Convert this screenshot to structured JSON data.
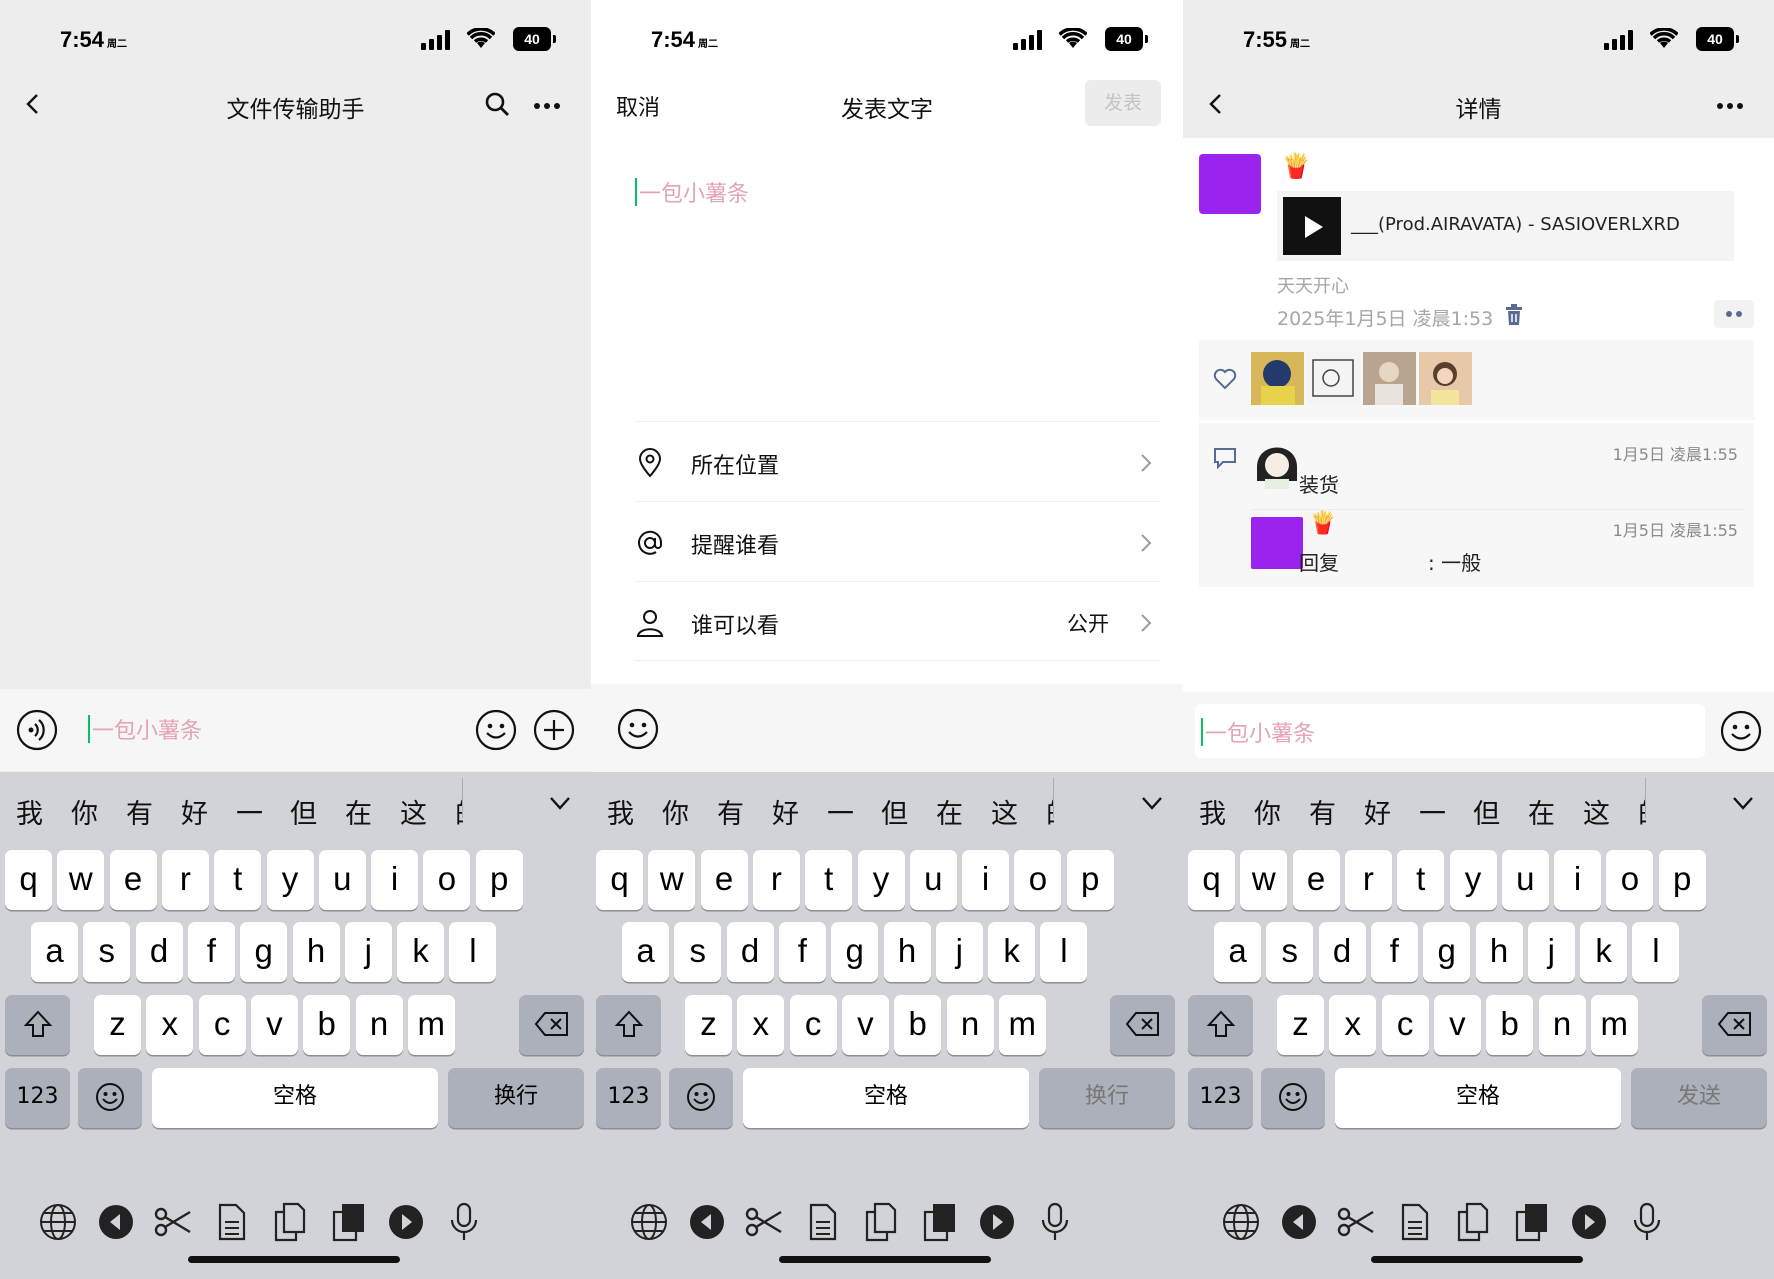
{
  "status": [
    {
      "time": "7:54",
      "day": "周二",
      "battery": "40"
    },
    {
      "time": "7:54",
      "day": "周二",
      "battery": "40"
    },
    {
      "time": "7:55",
      "day": "周二",
      "battery": "40"
    }
  ],
  "chat": {
    "title": "文件传输助手",
    "input_text": "一包小薯条"
  },
  "compose": {
    "cancel": "取消",
    "title": "发表文字",
    "publish": "发表",
    "draft_text": "一包小薯条",
    "options": [
      {
        "label": "所在位置",
        "value": "",
        "icon": "location-pin-icon"
      },
      {
        "label": "提醒谁看",
        "value": "",
        "icon": "at-icon"
      },
      {
        "label": "谁可以看",
        "value": "公开",
        "icon": "person-icon"
      }
    ]
  },
  "detail": {
    "title": "详情",
    "music_title": "___(Prod.AIRAVATA) - SASIOVERLXRD",
    "mood": "天天开心",
    "post_time": "2025年1月5日 凌晨1:53",
    "likes_colors": [
      "#d8b75a",
      "#f4f4f4",
      "#b9a48f",
      "#e7c9a9"
    ],
    "comments": [
      {
        "time": "1月5日 凌晨1:55",
        "text": "装货"
      },
      {
        "time": "1月5日 凌晨1:55",
        "text": "回复              : 一般"
      }
    ],
    "input_text": "一包小薯条"
  },
  "keyboard": {
    "candidates": [
      "我",
      "你",
      "有",
      "好",
      "一",
      "但",
      "在",
      "这"
    ],
    "row1": [
      "q",
      "w",
      "e",
      "r",
      "t",
      "y",
      "u",
      "i",
      "o",
      "p"
    ],
    "row2": [
      "a",
      "s",
      "d",
      "f",
      "g",
      "h",
      "j",
      "k",
      "l"
    ],
    "row3": [
      "z",
      "x",
      "c",
      "v",
      "b",
      "n",
      "m"
    ],
    "numbers": "123",
    "space": "空格",
    "return_labels": [
      "换行",
      "换行",
      "发送"
    ],
    "accent_purple": "#9b23ee",
    "caret_color": "#07c160",
    "placeholder_color": "#e3a4b3"
  }
}
